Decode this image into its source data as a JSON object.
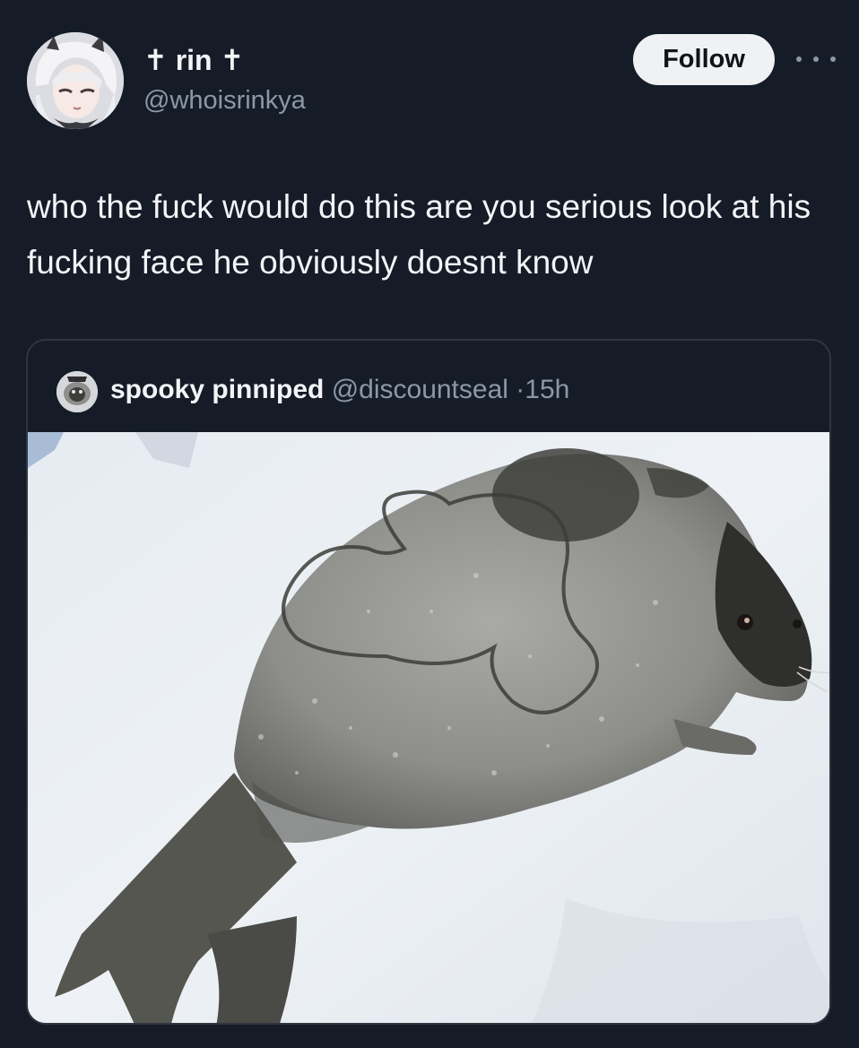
{
  "post": {
    "author": {
      "display_name": "✝ rin ✝",
      "handle": "@whoisrinkya",
      "avatar_icon": "anime-avatar-icon"
    },
    "follow_label": "Follow",
    "more_icon": "more-options-icon",
    "text": "who the fuck would do this are you serious look at his fucking face he obviously doesnt know"
  },
  "quote": {
    "author": {
      "display_name": "spooky pinniped",
      "handle": "@discountseal",
      "avatar_icon": "seal-avatar-icon"
    },
    "separator": "·",
    "time": "15h",
    "image_subject": "seal-photo"
  },
  "colors": {
    "background": "#151c28",
    "primary_text": "#f3f4f6",
    "secondary_text": "#8b98a5",
    "follow_button_bg": "#eff1f3",
    "card_border": "#2f3540"
  }
}
